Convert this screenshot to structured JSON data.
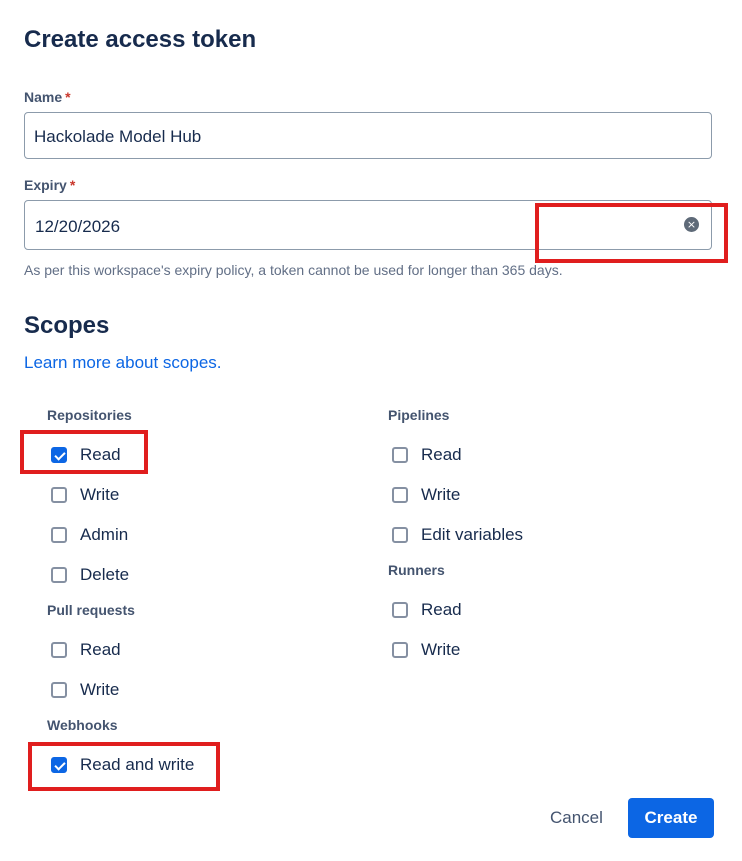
{
  "dialog": {
    "title": "Create access token",
    "name_label": "Name",
    "required_mark": "*",
    "name_value": "Hackolade Model Hub",
    "expiry_label": "Expiry",
    "expiry_value": "12/20/2026",
    "expiry_help": "As per this workspace's expiry policy, a token cannot be used for longer than 365 days.",
    "clear_icon": "×"
  },
  "scopes": {
    "title": "Scopes",
    "learn_more": "Learn more about scopes.",
    "repositories": {
      "label": "Repositories",
      "items": [
        {
          "label": "Read",
          "checked": true
        },
        {
          "label": "Write",
          "checked": false
        },
        {
          "label": "Admin",
          "checked": false
        },
        {
          "label": "Delete",
          "checked": false
        }
      ]
    },
    "pull_requests": {
      "label": "Pull requests",
      "items": [
        {
          "label": "Read",
          "checked": false
        },
        {
          "label": "Write",
          "checked": false
        }
      ]
    },
    "webhooks": {
      "label": "Webhooks",
      "items": [
        {
          "label": "Read and write",
          "checked": true
        }
      ]
    },
    "pipelines": {
      "label": "Pipelines",
      "items": [
        {
          "label": "Read",
          "checked": false
        },
        {
          "label": "Write",
          "checked": false
        },
        {
          "label": "Edit variables",
          "checked": false
        }
      ]
    },
    "runners": {
      "label": "Runners",
      "items": [
        {
          "label": "Read",
          "checked": false
        },
        {
          "label": "Write",
          "checked": false
        }
      ]
    }
  },
  "footer": {
    "cancel": "Cancel",
    "create": "Create"
  },
  "colors": {
    "accent": "#0c66e4",
    "highlight": "#e01e1e"
  }
}
